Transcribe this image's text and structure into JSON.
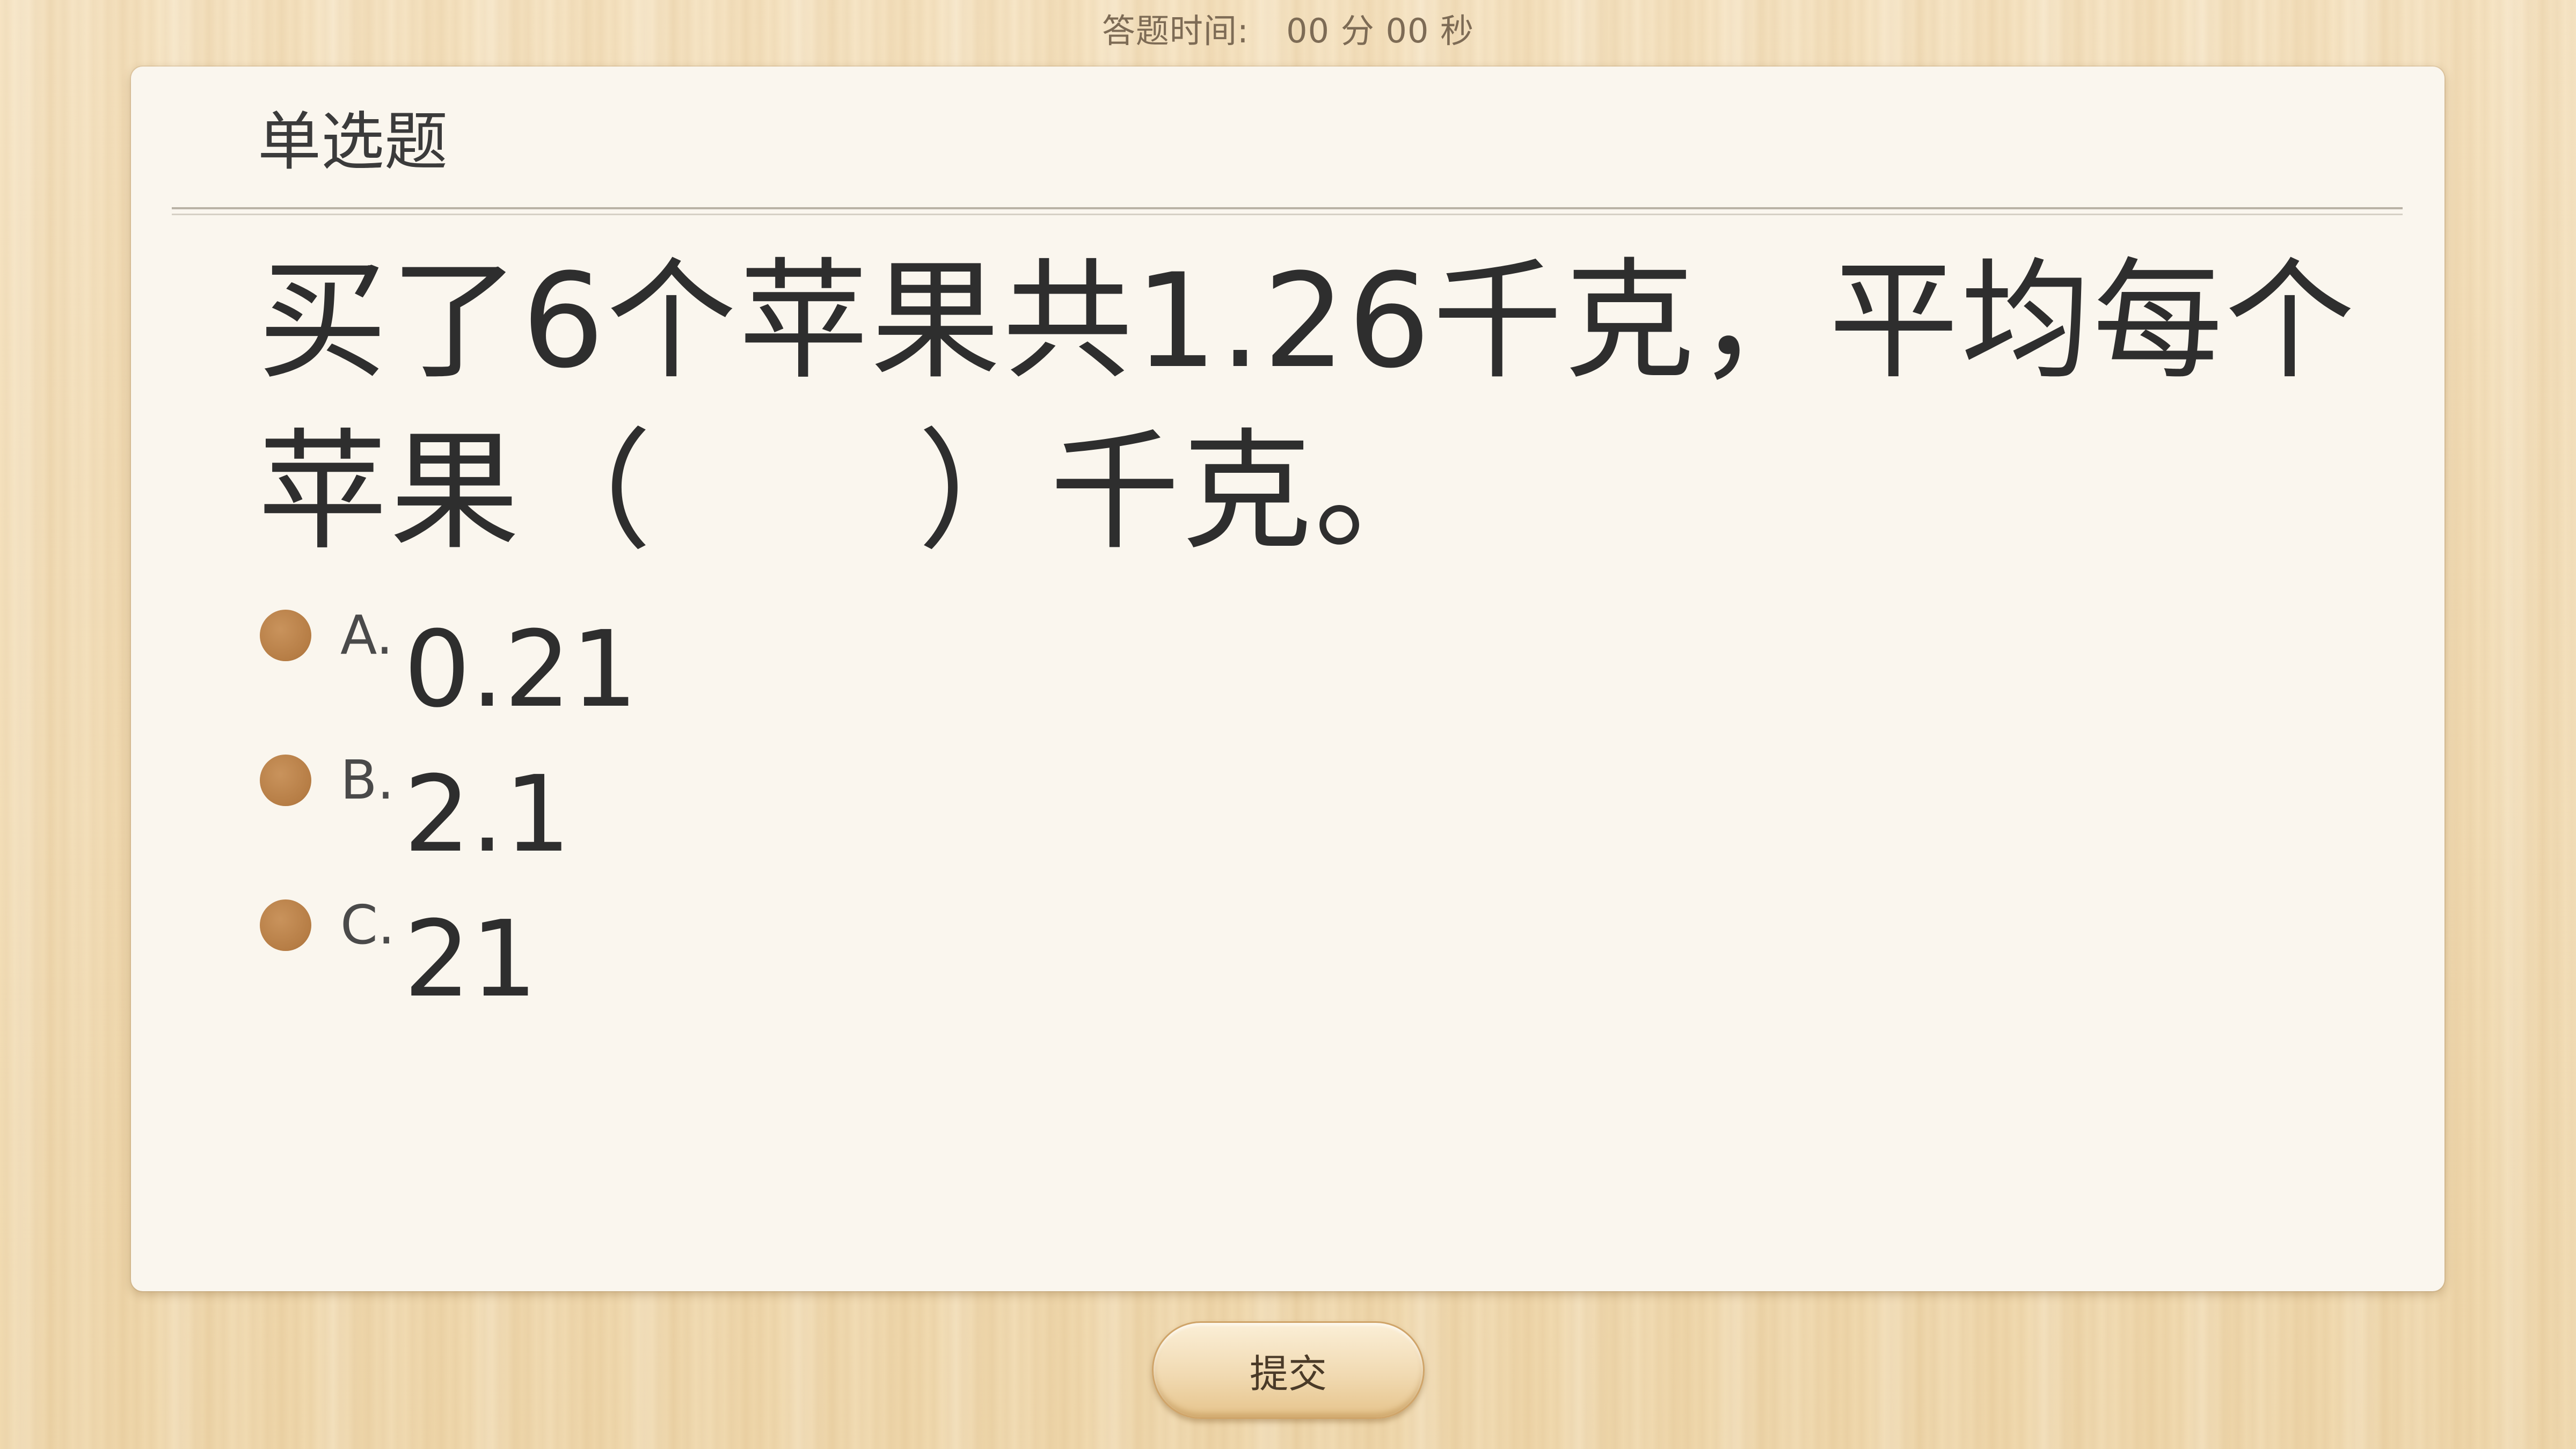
{
  "timer": {
    "label": "答题时间:",
    "minutes": "00",
    "minutes_unit": "分",
    "seconds": "00",
    "seconds_unit": "秒"
  },
  "question": {
    "type_label": "单选题",
    "text": "买了6个苹果共1.26千克，平均每个苹果（　　）千克。",
    "options": [
      {
        "letter": "A.",
        "value": "0.21"
      },
      {
        "letter": "B.",
        "value": "2.1"
      },
      {
        "letter": "C.",
        "value": "21"
      }
    ]
  },
  "submit": {
    "label": "提交"
  },
  "colors": {
    "background_wood": "#f3dfb9",
    "card": "#faf6ee",
    "option_dot": "#b67d45",
    "text": "#2e2e2e"
  }
}
